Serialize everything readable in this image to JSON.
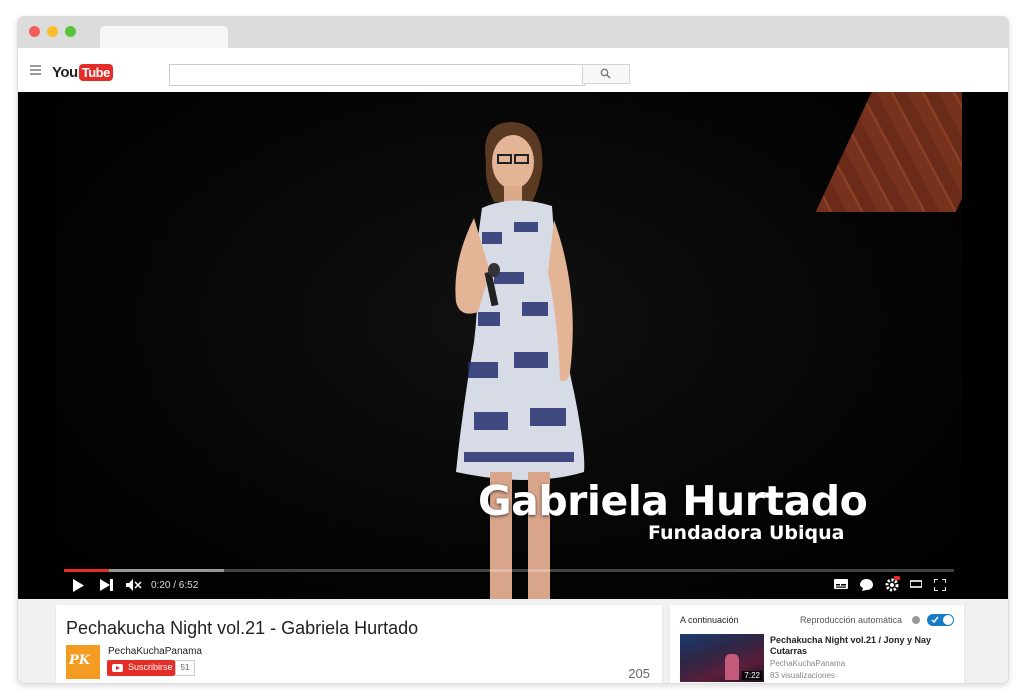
{
  "header": {
    "logo_you": "You",
    "logo_tube": "Tube",
    "search_placeholder": ""
  },
  "video": {
    "overlay_name": "Gabriela Hurtado",
    "overlay_role": "Fundadora  Ubiqua",
    "time_display": "0:20 / 6:52",
    "progress_played_percent": 5,
    "progress_buffered_percent": 18
  },
  "info": {
    "title": "Pechakucha Night vol.21 - Gabriela Hurtado",
    "channel_name": "PechaKuchaPanama",
    "channel_avatar_text": "PK",
    "subscribe_label": "Suscribirse",
    "subscriber_count": "51",
    "view_count": "205"
  },
  "up_next": {
    "label": "A continuación",
    "autoplay_label": "Reproducción automática",
    "autoplay_on": true,
    "item": {
      "title": "Pechakucha Night vol.21 / Jony y Nay Cutarras",
      "channel": "PechaKuchaPanama",
      "views": "83 visualizaciones",
      "duration": "7:22"
    }
  },
  "colors": {
    "brand_red": "#e52d27",
    "toggle_blue": "#167ac6",
    "avatar_orange": "#f39c21"
  }
}
